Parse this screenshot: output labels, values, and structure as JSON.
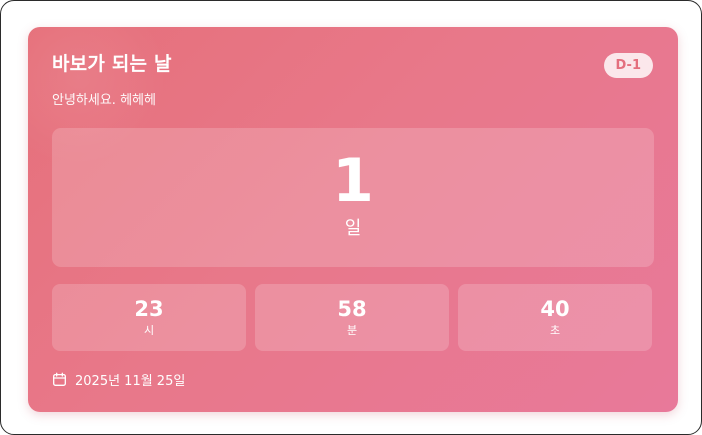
{
  "card": {
    "title": "바보가 되는 날",
    "badge": "D-1",
    "subtitle": "안녕하세요. 헤헤헤",
    "accent_color": "#e8788a",
    "badge_text_color": "#e46f7e",
    "date": "2025년 11월 25일",
    "date_icon": "calendar-icon"
  },
  "countdown": {
    "days": {
      "value": "1",
      "unit": "일"
    },
    "hours": {
      "value": "23",
      "unit": "시"
    },
    "minutes": {
      "value": "58",
      "unit": "분"
    },
    "seconds": {
      "value": "40",
      "unit": "초"
    }
  }
}
